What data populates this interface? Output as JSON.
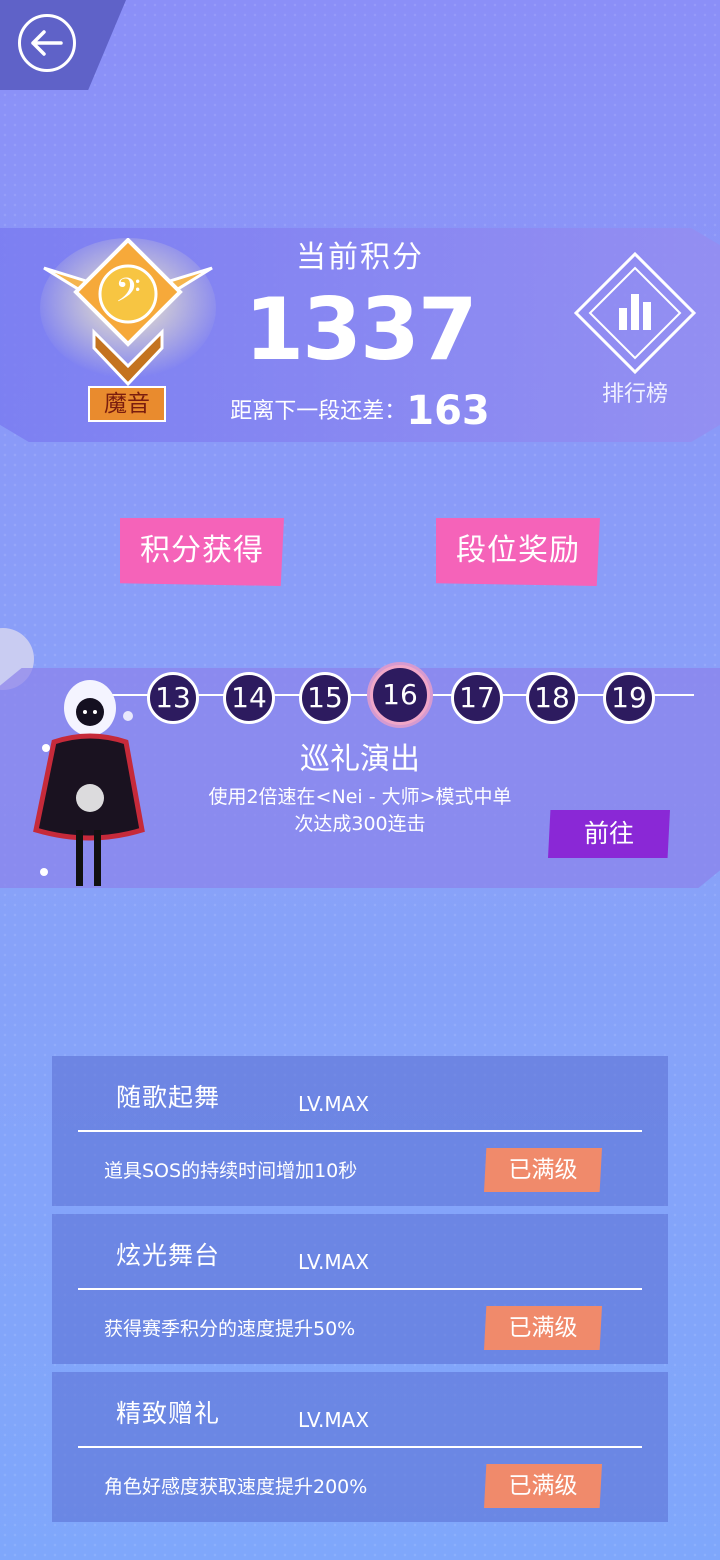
{
  "header": {
    "back_icon": "back-arrow-icon"
  },
  "score": {
    "title": "当前积分",
    "value": "1337",
    "next_prefix": "距离下一段还差：",
    "next_value": "163",
    "rank_name": "魔音",
    "rank_icon": "bass-clef-badge-icon"
  },
  "leaderboard": {
    "label": "排行榜",
    "icon": "bar-chart-diamond-icon"
  },
  "buttons": {
    "points_label": "积分获得",
    "rewards_label": "段位奖励"
  },
  "levels": {
    "items": [
      "13",
      "14",
      "15",
      "16",
      "17",
      "18",
      "19"
    ],
    "current": "16"
  },
  "task": {
    "title": "巡礼演出",
    "desc_line1": "使用2倍速在<Nei - 大师>模式中单",
    "desc_line2": "次达成300连击",
    "go_label": "前往"
  },
  "skills": [
    {
      "name": "随歌起舞",
      "level": "LV.MAX",
      "desc": "道具SOS的持续时间增加10秒",
      "status": "已满级"
    },
    {
      "name": "炫光舞台",
      "level": "LV.MAX",
      "desc": "获得赛季积分的速度提升50%",
      "status": "已满级"
    },
    {
      "name": "精致赠礼",
      "level": "LV.MAX",
      "desc": "角色好感度获取速度提升200%",
      "status": "已满级"
    }
  ],
  "colors": {
    "pink": "#f563b9",
    "purple": "#8a28d6",
    "orange": "#f08a6b",
    "badge": "#e98b2e"
  }
}
